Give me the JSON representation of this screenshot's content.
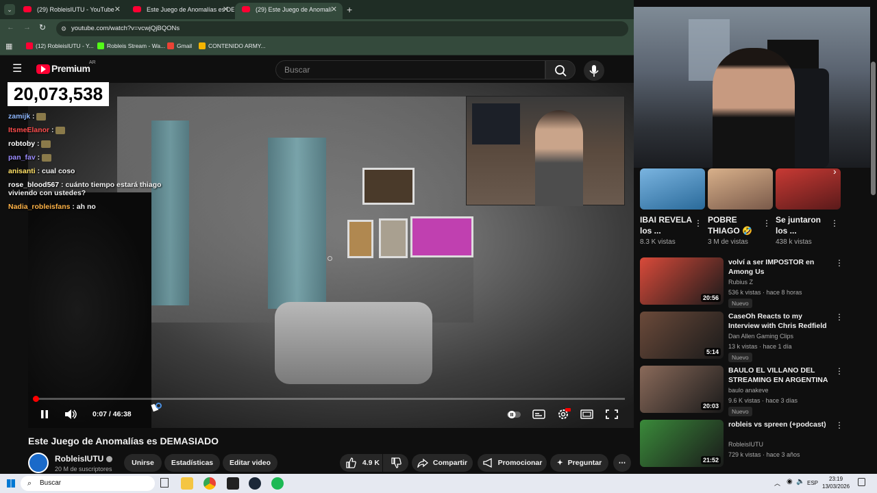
{
  "browser": {
    "tabs": [
      {
        "label": "(29) RobleisIUTU - YouTube",
        "active": false
      },
      {
        "label": "Este Juego de Anomalías es DE",
        "active": false
      },
      {
        "label": "(29) Este Juego de Anomalí",
        "active": true
      }
    ],
    "url": "youtube.com/watch?v=vcwjQjBQONs",
    "bookmarks": [
      {
        "label": "(12) RobleisIUTU - Y..."
      },
      {
        "label": "Robleis Stream - Wa..."
      },
      {
        "label": "Gmail"
      },
      {
        "label": "CONTENIDO ARMY..."
      }
    ]
  },
  "youtube": {
    "logo_text": "Premium",
    "logo_region": "AR",
    "search_placeholder": "Buscar"
  },
  "stream_overlay": {
    "counter": "20,073,538",
    "chat": [
      {
        "user": "zamijk",
        "msg": "",
        "color": "#8fb8ff"
      },
      {
        "user": "ItsmeElanor",
        "msg": "",
        "color": "#ff4d4d"
      },
      {
        "user": "robtoby",
        "msg": "",
        "color": "#ffffff"
      },
      {
        "user": "pan_fav",
        "msg": "",
        "color": "#9b8cff"
      },
      {
        "user": "anisanti",
        "msg": "cual coso",
        "color": "#ffe066"
      },
      {
        "user": "rose_blood567",
        "msg": "cuánto tiempo estará thiago viviendo con ustedes?",
        "color": "#ffffff"
      },
      {
        "user": "Nadia_robleisfans",
        "msg": "ah no",
        "color": "#ffb347"
      }
    ]
  },
  "player": {
    "time_current": "0:07",
    "time_total": "46:38",
    "progress_fraction": 0.0025
  },
  "video": {
    "title": "Este Juego de Anomalías es DEMASIADO",
    "channel": "RobleisIUTU",
    "subscribers": "20 M de suscriptores",
    "buttons": {
      "join": "Unirse",
      "stats": "Estadísticas",
      "edit": "Editar video",
      "likes": "4.9 K",
      "share": "Compartir",
      "promote": "Promocionar",
      "ask": "Preguntar"
    }
  },
  "shorts": [
    {
      "title1": "IBAI REVELA",
      "title2": "los ...",
      "views": "8.3 K vistas",
      "color": "#4a8fc4"
    },
    {
      "title1": "POBRE",
      "title2": "THIAGO 🤣",
      "views": "3 M de vistas",
      "color": "#c49a6c"
    },
    {
      "title1": "Se juntaron",
      "title2": "los ...",
      "views": "438 k vistas",
      "color": "#b8302a"
    }
  ],
  "recommended": [
    {
      "title": "volví a ser IMPOSTOR en Among Us",
      "channel": "Rubius Z",
      "meta": "536 k vistas · hace 8 horas",
      "badge": "Nuevo",
      "duration": "20:56",
      "color": "#d94a3a"
    },
    {
      "title": "CaseOh Reacts to my Interview with Chris Redfield",
      "channel": "Dan Allen Gaming Clips",
      "meta": "13 k vistas · hace 1 día",
      "badge": "Nuevo",
      "duration": "5:14",
      "color": "#6b4a3a"
    },
    {
      "title": "BAULO EL VILLANO DEL STREAMING EN ARGENTINA",
      "channel": "baulo anakeve",
      "meta": "9.6 K vistas · hace 3 días",
      "badge": "Nuevo",
      "duration": "20:03",
      "color": "#8a6a5a"
    },
    {
      "title": "robleis vs spreen (+podcast)",
      "channel": "RobleisIUTU",
      "meta": "729 k vistas · hace 3 años",
      "badge": "",
      "duration": "21:52",
      "color": "#3a8a3a"
    }
  ],
  "taskbar": {
    "search": "Buscar",
    "lang": "ESP",
    "time": "23:19",
    "date": "13/03/2026"
  }
}
